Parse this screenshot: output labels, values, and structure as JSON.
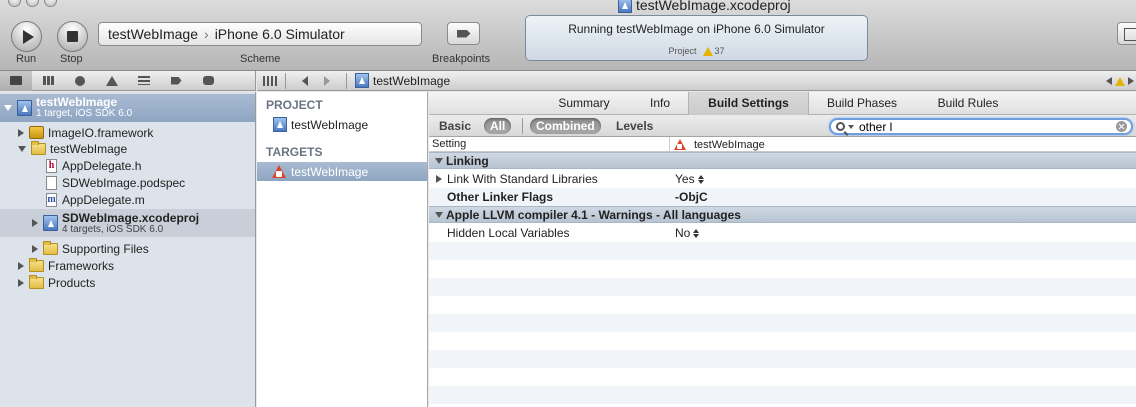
{
  "window": {
    "title": "testWebImage.xcodeproj"
  },
  "toolbar": {
    "run_label": "Run",
    "stop_label": "Stop",
    "scheme": {
      "target": "testWebImage",
      "destination": "iPhone 6.0 Simulator",
      "label": "Scheme"
    },
    "breakpoints_label": "Breakpoints",
    "activity": {
      "status": "Running testWebImage on iPhone 6.0 Simulator",
      "project_label": "Project",
      "warning_count": "37"
    }
  },
  "navigator": {
    "tabs": [
      "project-navigator",
      "symbol-navigator",
      "search-navigator",
      "issue-navigator",
      "debug-navigator",
      "breakpoint-navigator",
      "log-navigator"
    ],
    "project": {
      "name": "testWebImage",
      "subtitle": "1 target, iOS SDK 6.0"
    },
    "items": [
      {
        "label": "ImageIO.framework",
        "icon": "framework-icon"
      },
      {
        "label": "testWebImage",
        "icon": "folder-icon"
      },
      {
        "label": "AppDelegate.h",
        "icon": "h-file-icon"
      },
      {
        "label": "SDWebImage.podspec",
        "icon": "file-icon"
      },
      {
        "label": "AppDelegate.m",
        "icon": "m-file-icon"
      },
      {
        "label": "SDWebImage.xcodeproj",
        "sublabel": "4 targets, iOS SDK 6.0",
        "icon": "xcodeproj-icon"
      },
      {
        "label": "Supporting Files",
        "icon": "folder-icon"
      },
      {
        "label": "Frameworks",
        "icon": "folder-icon"
      },
      {
        "label": "Products",
        "icon": "folder-icon"
      }
    ]
  },
  "jump_bar": {
    "crumb": "testWebImage"
  },
  "project_list": {
    "project_header": "PROJECT",
    "project_item": "testWebImage",
    "targets_header": "TARGETS",
    "target_item": "testWebImage"
  },
  "editor": {
    "tabs": [
      "Summary",
      "Info",
      "Build Settings",
      "Build Phases",
      "Build Rules"
    ],
    "active_tab": "Build Settings",
    "filters": {
      "basic": "Basic",
      "all": "All",
      "combined": "Combined",
      "levels": "Levels"
    },
    "search": {
      "value": "other l"
    },
    "columns": {
      "setting": "Setting",
      "target": "testWebImage"
    },
    "groups": [
      {
        "title": "Linking",
        "rows": [
          {
            "name": "Link With Standard Libraries",
            "value": "Yes"
          },
          {
            "name": "Other Linker Flags",
            "value": "-ObjC"
          }
        ]
      },
      {
        "title": "Apple LLVM compiler 4.1 - Warnings - All languages",
        "rows": [
          {
            "name": "Hidden Local Variables",
            "value": "No"
          }
        ]
      }
    ]
  },
  "colors": {
    "selection": "#8ea5c2",
    "navigator_bg": "#dde3ea",
    "search_focus": "#6d9fe0",
    "warning": "#e5b400"
  }
}
